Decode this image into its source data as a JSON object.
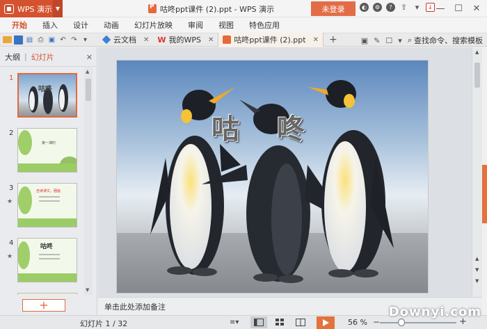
{
  "app": {
    "name": "WPS 演示",
    "doc_title": "咕咚ppt课件 (2).ppt - WPS 演示",
    "login_label": "未登录"
  },
  "menu": [
    "开始",
    "插入",
    "设计",
    "动画",
    "幻灯片放映",
    "审阅",
    "视图",
    "特色应用"
  ],
  "tabs": [
    {
      "label": "云文档",
      "icon": "cloud-icon"
    },
    {
      "label": "我的WPS",
      "icon": "wps-icon"
    },
    {
      "label": "咕咚ppt课件 (2).ppt",
      "icon": "ppt-file-icon",
      "active": true
    }
  ],
  "search": {
    "label": "查找命令、搜索模板"
  },
  "left_panel": {
    "tab_outline": "大纲",
    "tab_slides": "幻灯片",
    "slides": [
      {
        "num": "1",
        "thumb_title": "咕咚",
        "active": true
      },
      {
        "num": "2",
        "thumb_title": "第一课时"
      },
      {
        "num": "3",
        "thumb_title": "自读课文，圈画"
      },
      {
        "num": "4",
        "thumb_title": "咕咚"
      }
    ],
    "add_slide_label": "+"
  },
  "slide": {
    "title": "咕 咚"
  },
  "notes_placeholder": "单击此处添加备注",
  "status": {
    "slide_counter": "幻灯片 1 / 32",
    "zoom_label": "56 %",
    "zoom_level": 0.3
  },
  "watermark": "Downyi.com",
  "colors": {
    "accent": "#d4522f",
    "login": "#e36c47",
    "play": "#e3723d"
  }
}
